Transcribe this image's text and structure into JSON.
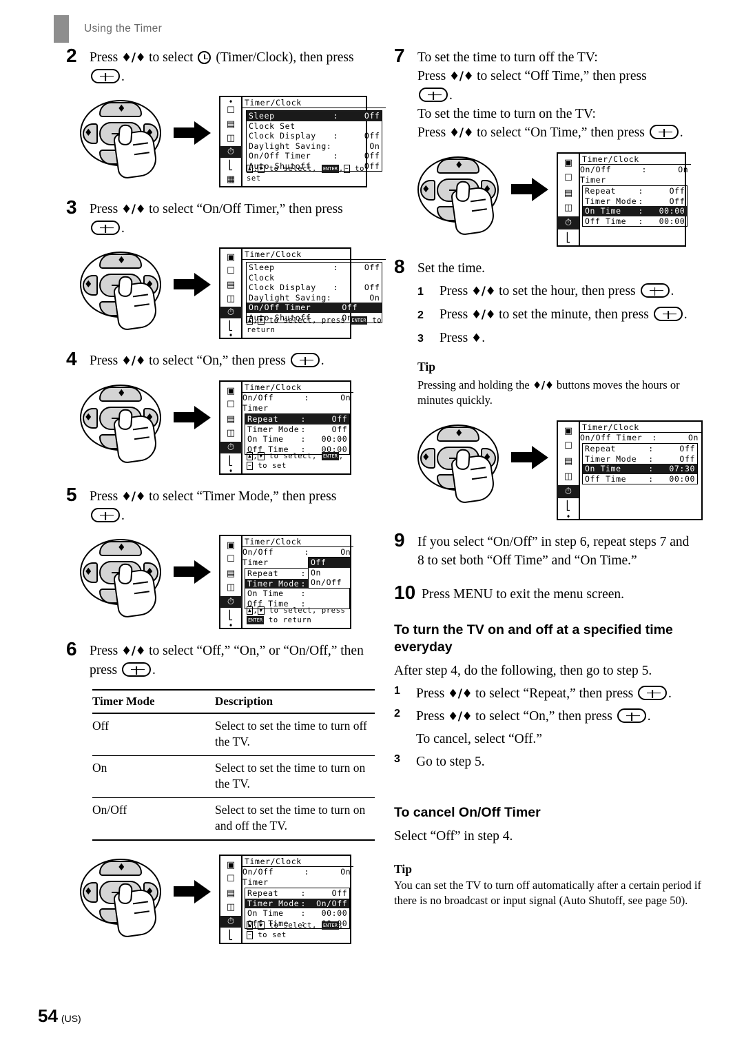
{
  "running_head": "Using the Timer",
  "page_footer": {
    "number": "54",
    "region": "(US)"
  },
  "left_column": {
    "step2": {
      "num": "2",
      "text_a": "Press ",
      "text_b": " to select ",
      "text_c": " (Timer/Clock), then press ",
      "text_d": "."
    },
    "step3": {
      "num": "3",
      "text_a": "Press ",
      "text_b": " to select “On/Off Timer,” then press ",
      "text_c": "."
    },
    "step4": {
      "num": "4",
      "text_a": "Press ",
      "text_b": " to select “On,” then press ",
      "text_c": "."
    },
    "step5": {
      "num": "5",
      "text_a": "Press ",
      "text_b": " to select “Timer Mode,” then press ",
      "text_c": "."
    },
    "step6": {
      "num": "6",
      "text_a": "Press ",
      "text_b": " to select “Off,” “On,” or “On/Off,” then press ",
      "text_c": "."
    },
    "timer_mode_table": {
      "headers": [
        "Timer Mode",
        "Description"
      ],
      "rows": [
        [
          "Off",
          "Select to set the time to turn off the TV."
        ],
        [
          "On",
          "Select to set the time to turn on the TV."
        ],
        [
          "On/Off",
          "Select to set the time to turn on and off the TV."
        ]
      ]
    }
  },
  "right_column": {
    "step7": {
      "num": "7",
      "line1": "To set the time to turn off the TV:",
      "line2_a": "Press ",
      "line2_b": " to select “Off Time,” then press ",
      "line2_c": ".",
      "line3": "To set the time to turn on the TV:",
      "line4_a": "Press ",
      "line4_b": " to select “On Time,” then press ",
      "line4_c": "."
    },
    "step8": {
      "num": "8",
      "title": "Set the time.",
      "sub1_num": "1",
      "sub1_a": "Press ",
      "sub1_b": " to set the hour, then press ",
      "sub1_c": ".",
      "sub2_num": "2",
      "sub2_a": "Press ",
      "sub2_b": " to set the minute, then press ",
      "sub2_c": ".",
      "sub3_num": "3",
      "sub3_a": "Press ",
      "sub3_b": ".",
      "tip_head": "Tip",
      "tip_a": "Pressing and holding the ",
      "tip_b": " buttons moves the hours or minutes quickly."
    },
    "step9": {
      "num": "9",
      "text": "If you select “On/Off” in step 6, repeat steps 7 and 8 to set both “Off Time” and “On Time.”"
    },
    "step10": {
      "num": "10",
      "text": "Press MENU to exit the menu screen."
    },
    "section_everyday": {
      "heading": "To turn the TV on and off at a specified time everyday",
      "intro": "After step 4, do the following, then go to step 5.",
      "sub1_num": "1",
      "sub1_a": "Press ",
      "sub1_b": " to select “Repeat,” then press ",
      "sub1_c": ".",
      "sub2_num": "2",
      "sub2_a": "Press ",
      "sub2_b": " to select “On,” then press ",
      "sub2_c": ".",
      "sub2_note": "To cancel, select “Off.”",
      "sub3_num": "3",
      "sub3_text": "Go to step 5."
    },
    "section_cancel": {
      "heading": "To cancel On/Off Timer",
      "text": "Select “Off” in step 4.",
      "tip_head": "Tip",
      "tip_text": "You can set the TV to turn off automatically after a certain period if there is no broadcast or input signal (Auto Shutoff, see page 50)."
    }
  },
  "osd_screens": {
    "screen_step2": {
      "title": "Timer/Clock",
      "rail_icons": [
        "tv-icon",
        "video-icon",
        "audio-icon",
        "clock-icon",
        "antenna-icon",
        "windows-icon"
      ],
      "rail_selected_index": 3,
      "rows": [
        {
          "label": "Sleep",
          "sep": ":",
          "value": "Off",
          "highlight": true
        },
        {
          "label": "Clock Set",
          "sep": "",
          "value": "",
          "highlight": false
        },
        {
          "label": "Clock Display",
          "sep": ":",
          "value": "Off",
          "highlight": false
        },
        {
          "label": "Daylight Saving:",
          "sep": "",
          "value": "On",
          "highlight": false
        },
        {
          "label": "On/Off Timer",
          "sep": ":",
          "value": "Off",
          "highlight": false
        },
        {
          "label": "Auto Shutoff",
          "sep": ":",
          "value": "Off",
          "highlight": false
        }
      ],
      "hint": ", to select, , to set"
    },
    "screen_step3": {
      "title": "Timer/Clock",
      "rail_icons": [
        "picture-icon",
        "tv-icon",
        "video-icon",
        "audio-icon",
        "clock-icon",
        "antenna-icon"
      ],
      "rail_selected_index": 4,
      "rows": [
        {
          "label": "Sleep",
          "sep": ":",
          "value": "Off",
          "highlight": false
        },
        {
          "label": "Clock",
          "sep": "",
          "value": "",
          "highlight": false
        },
        {
          "label": "Clock Display",
          "sep": ":",
          "value": "Off",
          "highlight": false
        },
        {
          "label": "Daylight Saving:",
          "sep": "",
          "value": "On",
          "highlight": false
        },
        {
          "label": "On/Off Timer",
          "sep": "",
          "value": "Off",
          "highlight": true
        },
        {
          "label": "Auto Shutoff",
          "sep": "",
          "value": "On",
          "highlight": false
        }
      ],
      "hint": ", to select, press  to return"
    },
    "screen_step4": {
      "title": "Timer/Clock",
      "subheader_label": "On/Off Timer",
      "subheader_sep": ":",
      "subheader_value": "On",
      "rail_icons": [
        "picture-icon",
        "tv-icon",
        "video-icon",
        "audio-icon",
        "clock-icon",
        "antenna-icon"
      ],
      "rail_selected_index": 4,
      "rows": [
        {
          "label": "Repeat",
          "sep": ":",
          "value": "Off",
          "highlight": true
        },
        {
          "label": "Timer Mode",
          "sep": ":",
          "value": "Off",
          "highlight": false
        },
        {
          "label": "On Time",
          "sep": ":",
          "value": "00:00",
          "highlight": false
        },
        {
          "label": "Off Time",
          "sep": ":",
          "value": "00:00",
          "highlight": false
        }
      ],
      "hint": ", to select, , to set"
    },
    "screen_step5": {
      "title": "Timer/Clock",
      "subheader_label": "On/Off Timer",
      "subheader_sep": ":",
      "subheader_value": "On",
      "rail_icons": [
        "picture-icon",
        "tv-icon",
        "video-icon",
        "audio-icon",
        "clock-icon",
        "antenna-icon"
      ],
      "rail_selected_index": 4,
      "rows": [
        {
          "label": "Repeat",
          "sep": ":",
          "value": "Off",
          "highlight": false
        },
        {
          "label": "Timer Mode",
          "sep": ":",
          "value": "",
          "highlight": true
        },
        {
          "label": "On Time",
          "sep": ":",
          "value": "",
          "highlight": false
        },
        {
          "label": "Off Time",
          "sep": ":",
          "value": "",
          "highlight": false
        }
      ],
      "popup_options": [
        "Off",
        "On",
        "On/Off"
      ],
      "popup_selected_index": 0,
      "hint": ", to select, press  to return"
    },
    "screen_step6": {
      "title": "Timer/Clock",
      "subheader_label": "On/Off Timer",
      "subheader_sep": ":",
      "subheader_value": "On",
      "rail_icons": [
        "picture-icon",
        "tv-icon",
        "video-icon",
        "audio-icon",
        "clock-icon",
        "antenna-icon"
      ],
      "rail_selected_index": 4,
      "rows": [
        {
          "label": "Repeat",
          "sep": ":",
          "value": "Off",
          "highlight": false
        },
        {
          "label": "Timer Mode",
          "sep": ":",
          "value": "On/Off",
          "highlight": true
        },
        {
          "label": "On Time",
          "sep": ":",
          "value": "00:00",
          "highlight": false
        },
        {
          "label": "Off Time",
          "sep": ":",
          "value": "00:00",
          "highlight": false
        }
      ],
      "hint": ", to select, , to set"
    },
    "screen_step7": {
      "title": "Timer/Clock",
      "subheader_label": "On/Off Timer",
      "subheader_sep": ":",
      "subheader_value": "On",
      "rail_icons": [
        "picture-icon",
        "tv-icon",
        "video-icon",
        "audio-icon",
        "clock-icon",
        "antenna-icon"
      ],
      "rail_selected_index": 4,
      "rows": [
        {
          "label": "Repeat",
          "sep": ":",
          "value": "Off",
          "highlight": false
        },
        {
          "label": "Timer Mode",
          "sep": ":",
          "value": "Off",
          "highlight": false
        },
        {
          "label": "On Time",
          "sep": ":",
          "value": "00:00",
          "highlight": true
        },
        {
          "label": "Off Time",
          "sep": ":",
          "value": "00:00",
          "highlight": false
        }
      ],
      "hint": ""
    },
    "screen_step8": {
      "title": "Timer/Clock",
      "subheader_label": "On/Off Timer",
      "subheader_sep": ":",
      "subheader_value": "On",
      "rail_icons": [
        "picture-icon",
        "tv-icon",
        "video-icon",
        "audio-icon",
        "clock-icon",
        "antenna-icon"
      ],
      "rail_selected_index": 4,
      "rows": [
        {
          "label": "Repeat",
          "sep": ":",
          "value": "Off",
          "highlight": false
        },
        {
          "label": "Timer Mode",
          "sep": ":",
          "value": "Off",
          "highlight": false
        },
        {
          "label": "On Time",
          "sep": ":",
          "value": "07:30",
          "highlight": true
        },
        {
          "label": "Off Time",
          "sep": ":",
          "value": "00:00",
          "highlight": false
        }
      ],
      "hint": ""
    }
  }
}
